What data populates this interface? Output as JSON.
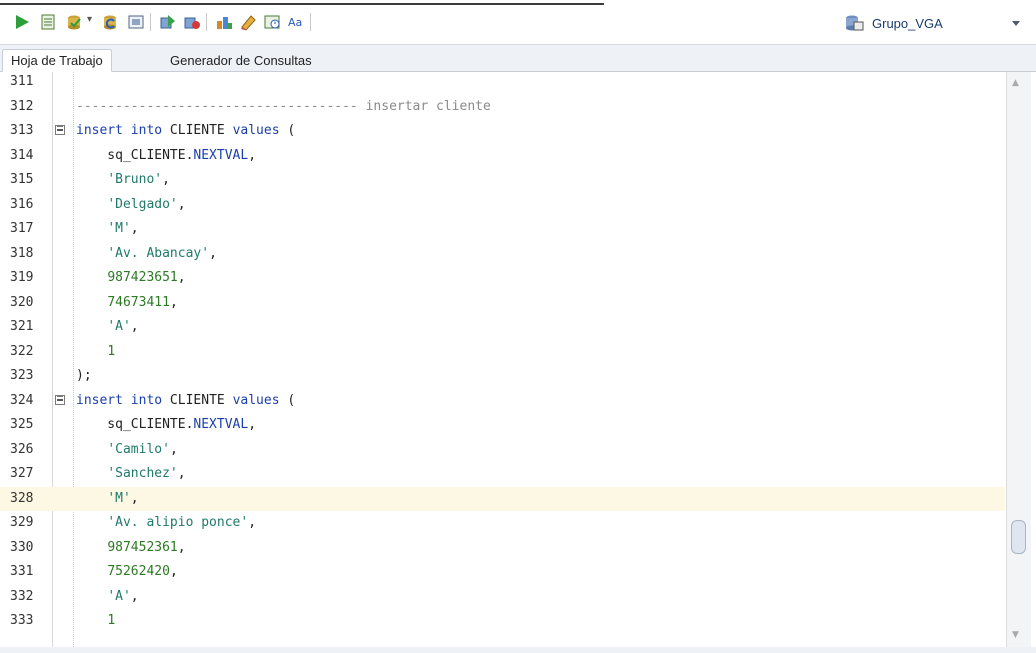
{
  "toolbar": {
    "buttons": [
      {
        "icon": "run-statement-icon"
      },
      {
        "icon": "run-script-icon"
      },
      {
        "icon": "commit-icon"
      },
      {
        "icon": "rollback-icon"
      },
      {
        "icon": "cancel-icon"
      },
      {
        "icon": "sql-tuning-icon"
      },
      {
        "icon": "explain-plan-icon"
      },
      {
        "icon": "autotrace-icon"
      },
      {
        "icon": "clear-icon"
      },
      {
        "icon": "history-icon"
      },
      {
        "icon": "format-case-icon"
      }
    ],
    "connection": "Grupo_VGA"
  },
  "tabs": [
    {
      "label": "Hoja de Trabajo",
      "active": true
    },
    {
      "label": "Generador de Consultas",
      "active": false
    }
  ],
  "editor": {
    "highlighted_line": "328",
    "lines": [
      {
        "num": "311",
        "text": ""
      },
      {
        "num": "312",
        "text": "------------------------------------ insertar cliente"
      },
      {
        "num": "313",
        "text": "insert into CLIENTE values ("
      },
      {
        "num": "314",
        "text": "    sq_CLIENTE.NEXTVAL,"
      },
      {
        "num": "315",
        "text": "    'Bruno',"
      },
      {
        "num": "316",
        "text": "    'Delgado',"
      },
      {
        "num": "317",
        "text": "    'M',"
      },
      {
        "num": "318",
        "text": "    'Av. Abancay',"
      },
      {
        "num": "319",
        "text": "    987423651,"
      },
      {
        "num": "320",
        "text": "    74673411,"
      },
      {
        "num": "321",
        "text": "    'A',"
      },
      {
        "num": "322",
        "text": "    1"
      },
      {
        "num": "323",
        "text": ");"
      },
      {
        "num": "324",
        "text": "insert into CLIENTE values ("
      },
      {
        "num": "325",
        "text": "    sq_CLIENTE.NEXTVAL,"
      },
      {
        "num": "326",
        "text": "    'Camilo',"
      },
      {
        "num": "327",
        "text": "    'Sanchez',"
      },
      {
        "num": "328",
        "text": "    'M',"
      },
      {
        "num": "329",
        "text": "    'Av. alipio ponce',"
      },
      {
        "num": "330",
        "text": "    987452361,"
      },
      {
        "num": "331",
        "text": "    75262420,"
      },
      {
        "num": "332",
        "text": "    'A',"
      },
      {
        "num": "333",
        "text": "    1"
      }
    ]
  },
  "colors": {
    "keyword": "#1b3fa8",
    "string": "#1f7a6a",
    "number": "#2b7a23",
    "comment": "#8a8a8a",
    "current_line": "#fdf8e4"
  }
}
